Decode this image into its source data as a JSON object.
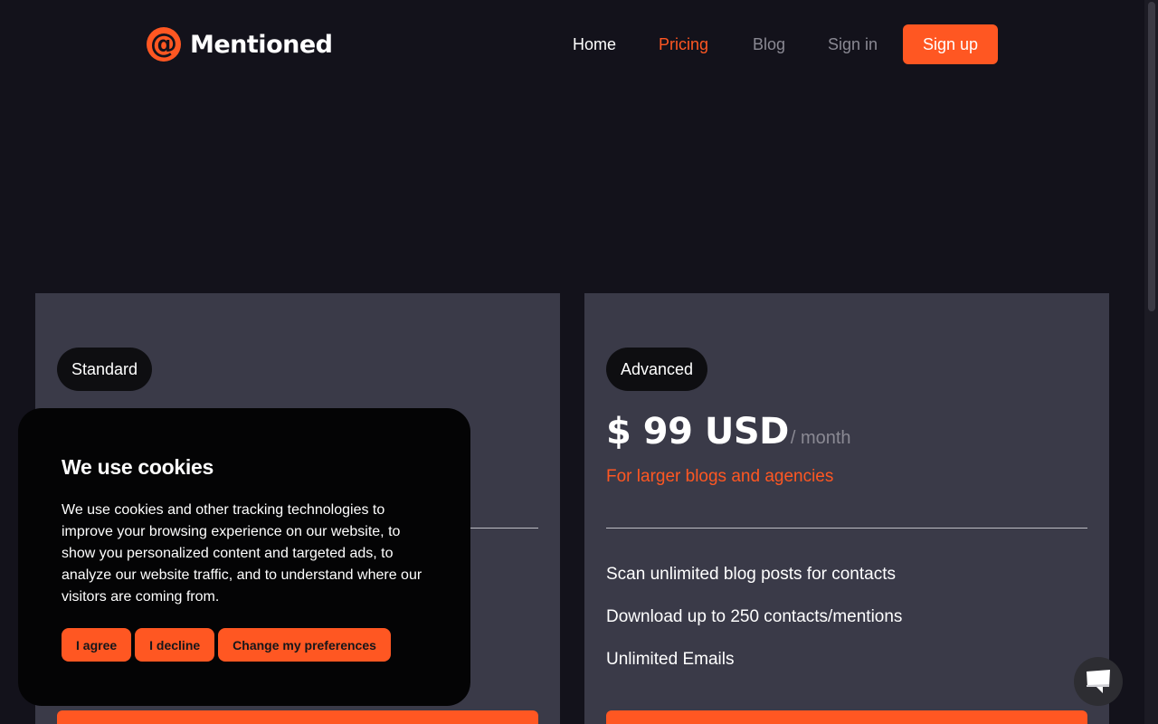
{
  "brand": {
    "name": "Mentioned",
    "logo_glyph": "@",
    "accent_color": "#ff5722",
    "background_color": "#13121b",
    "card_color": "#3a3a48"
  },
  "nav": {
    "home": "Home",
    "pricing": "Pricing",
    "blog": "Blog",
    "sign_in": "Sign in",
    "sign_up": "Sign up"
  },
  "plans": {
    "standard": {
      "name": "Standard"
    },
    "advanced": {
      "name": "Advanced",
      "price": "$ 99 USD",
      "period": "/ month",
      "description": "For larger blogs and agencies",
      "features": [
        "Scan unlimited blog posts for contacts",
        "Download up to 250 contacts/mentions",
        "Unlimited Emails"
      ]
    }
  },
  "cookie_banner": {
    "title": "We use cookies",
    "body": "We use cookies and other tracking technologies to improve your browsing experience on our website, to show you personalized content and targeted ads, to analyze our website traffic, and to understand where our visitors are coming from.",
    "agree": "I agree",
    "decline": "I decline",
    "preferences": "Change my preferences"
  },
  "icons": {
    "chat": "chat-bubble-icon"
  }
}
